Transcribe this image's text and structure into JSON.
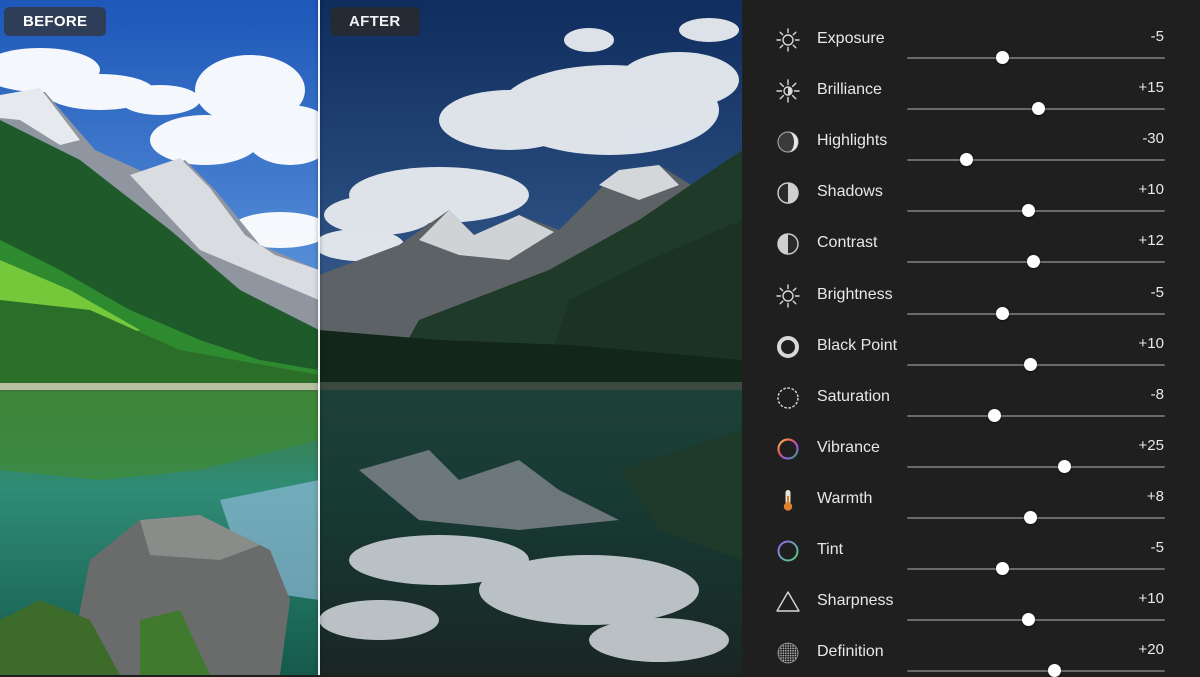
{
  "compare": {
    "before_label": "BEFORE",
    "after_label": "AFTER"
  },
  "adjustments": [
    {
      "name": "Exposure",
      "value": "-5",
      "level": 0.37,
      "icon": "exposure-sun-icon"
    },
    {
      "name": "Brilliance",
      "value": "+15",
      "level": 0.51,
      "icon": "brilliance-icon"
    },
    {
      "name": "Highlights",
      "value": "-30",
      "level": 0.23,
      "icon": "highlights-icon"
    },
    {
      "name": "Shadows",
      "value": "+10",
      "level": 0.47,
      "icon": "shadows-icon"
    },
    {
      "name": "Contrast",
      "value": "+12",
      "level": 0.49,
      "icon": "contrast-icon"
    },
    {
      "name": "Brightness",
      "value": "-5",
      "level": 0.37,
      "icon": "brightness-sun-icon"
    },
    {
      "name": "Black Point",
      "value": "+10",
      "level": 0.48,
      "icon": "black-point-icon"
    },
    {
      "name": "Saturation",
      "value": "-8",
      "level": 0.34,
      "icon": "saturation-icon"
    },
    {
      "name": "Vibrance",
      "value": "+25",
      "level": 0.61,
      "icon": "vibrance-icon"
    },
    {
      "name": "Warmth",
      "value": "+8",
      "level": 0.48,
      "icon": "thermometer-icon"
    },
    {
      "name": "Tint",
      "value": "-5",
      "level": 0.37,
      "icon": "tint-icon"
    },
    {
      "name": "Sharpness",
      "value": "+10",
      "level": 0.47,
      "icon": "sharpness-triangle-icon"
    },
    {
      "name": "Definition",
      "value": "+20",
      "level": 0.57,
      "icon": "definition-icon"
    }
  ],
  "colors": {
    "panel_bg": "#1f1f1f",
    "track": "#6a6a6a",
    "thumb": "#ffffff",
    "text": "#e8e8e8"
  }
}
